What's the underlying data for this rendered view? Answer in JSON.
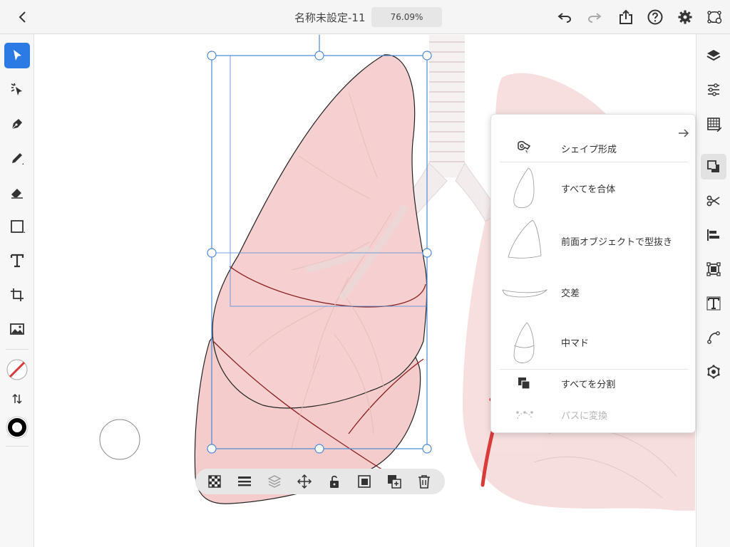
{
  "header": {
    "title": "名称未設定-11",
    "zoom": "76.09%"
  },
  "panel": {
    "items": [
      {
        "label": "シェイプ形成",
        "icon": "shape-builder-icon",
        "enabled": true
      },
      {
        "label": "すべてを合体",
        "icon": "unite-preview-icon",
        "enabled": true
      },
      {
        "label": "前面オブジェクトで型抜き",
        "icon": "minus-front-preview-icon",
        "enabled": true
      },
      {
        "label": "交差",
        "icon": "intersect-preview-icon",
        "enabled": true
      },
      {
        "label": "中マド",
        "icon": "exclude-preview-icon",
        "enabled": true
      },
      {
        "label": "すべてを分割",
        "icon": "divide-icon",
        "enabled": true
      },
      {
        "label": "パスに変換",
        "icon": "convert-to-path-icon",
        "enabled": false
      }
    ]
  },
  "colors": {
    "accent": "#2c7be5",
    "lung_fill": "#f4c9c9",
    "annotation_arrow": "#d93b3b",
    "selection": "#4a8ad6"
  }
}
